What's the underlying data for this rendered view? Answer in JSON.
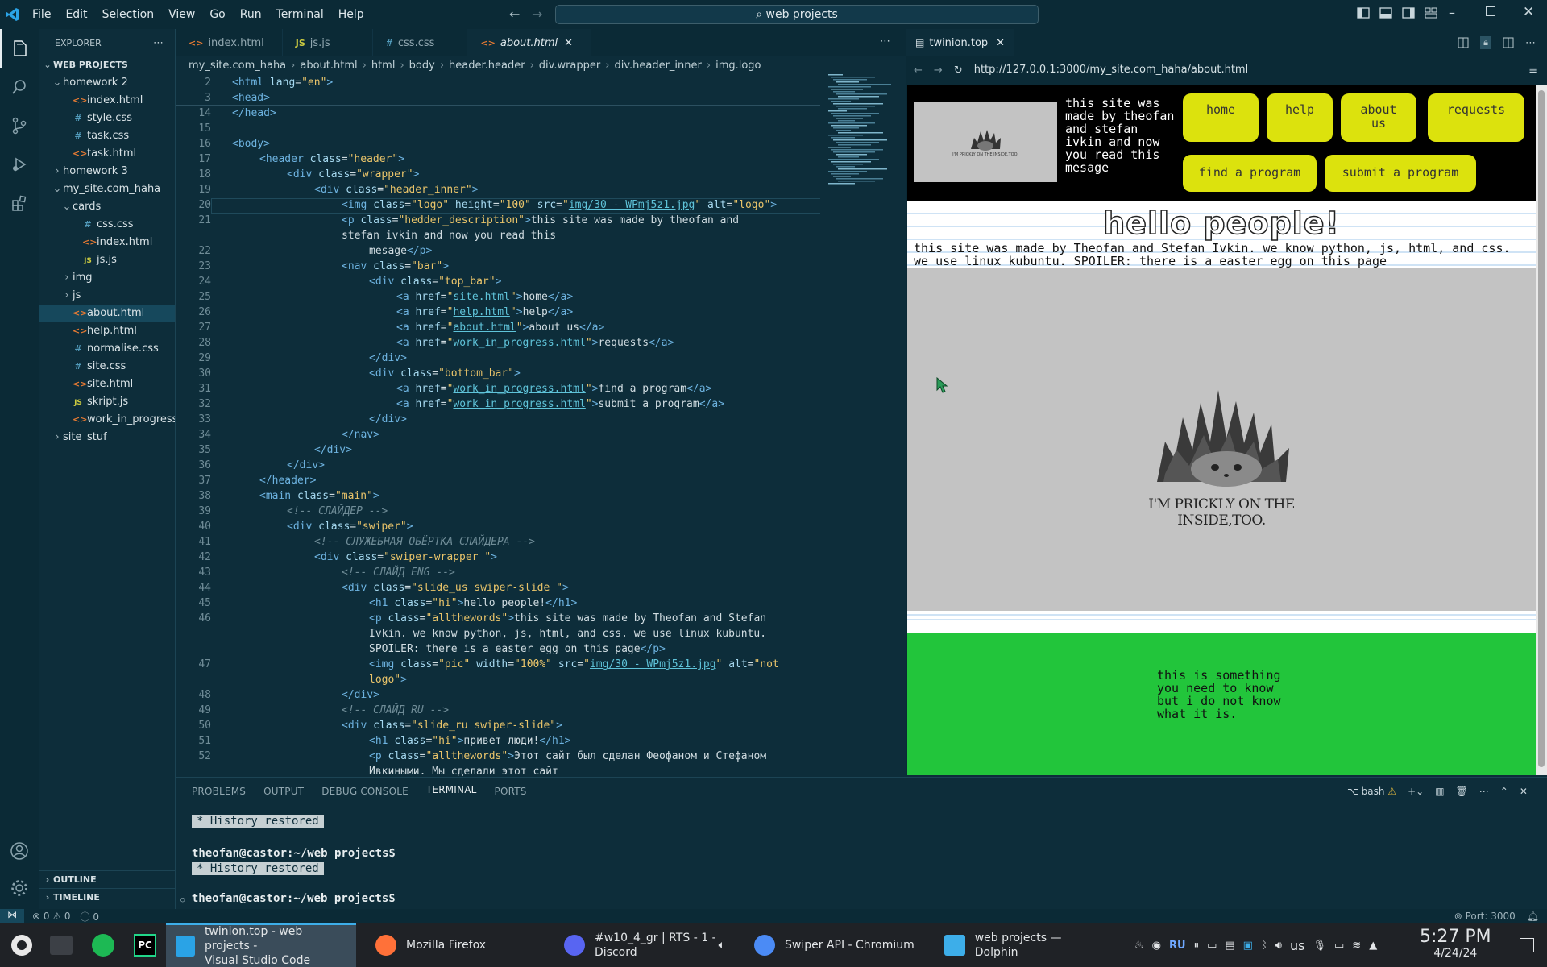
{
  "menubar": {
    "items": [
      "File",
      "Edit",
      "Selection",
      "View",
      "Go",
      "Run",
      "Terminal",
      "Help"
    ],
    "search": "web projects"
  },
  "explorer": {
    "title": "EXPLORER",
    "workspace": "WEB PROJECTS",
    "outline": "OUTLINE",
    "timeline": "TIMELINE",
    "items": [
      {
        "label": "homework 2",
        "kind": "folder-open",
        "indent": 1,
        "icon": ""
      },
      {
        "label": "index.html",
        "kind": "file",
        "indent": 2,
        "icon": "<>",
        "color": "#e37933"
      },
      {
        "label": "style.css",
        "kind": "file",
        "indent": 2,
        "icon": "#",
        "color": "#519aba"
      },
      {
        "label": "task.css",
        "kind": "file",
        "indent": 2,
        "icon": "#",
        "color": "#519aba"
      },
      {
        "label": "task.html",
        "kind": "file",
        "indent": 2,
        "icon": "<>",
        "color": "#e37933"
      },
      {
        "label": "homework 3",
        "kind": "folder",
        "indent": 1,
        "icon": ""
      },
      {
        "label": "my_site.com_haha",
        "kind": "folder-open",
        "indent": 1,
        "icon": ""
      },
      {
        "label": "cards",
        "kind": "folder-open",
        "indent": 2,
        "icon": ""
      },
      {
        "label": "css.css",
        "kind": "file",
        "indent": 3,
        "icon": "#",
        "color": "#519aba"
      },
      {
        "label": "index.html",
        "kind": "file",
        "indent": 3,
        "icon": "<>",
        "color": "#e37933"
      },
      {
        "label": "js.js",
        "kind": "file",
        "indent": 3,
        "icon": "JS",
        "color": "#cbcb41"
      },
      {
        "label": "img",
        "kind": "folder",
        "indent": 2,
        "icon": ""
      },
      {
        "label": "js",
        "kind": "folder",
        "indent": 2,
        "icon": ""
      },
      {
        "label": "about.html",
        "kind": "file",
        "indent": 2,
        "icon": "<>",
        "color": "#e37933",
        "selected": true
      },
      {
        "label": "help.html",
        "kind": "file",
        "indent": 2,
        "icon": "<>",
        "color": "#e37933"
      },
      {
        "label": "normalise.css",
        "kind": "file",
        "indent": 2,
        "icon": "#",
        "color": "#519aba"
      },
      {
        "label": "site.css",
        "kind": "file",
        "indent": 2,
        "icon": "#",
        "color": "#519aba"
      },
      {
        "label": "site.html",
        "kind": "file",
        "indent": 2,
        "icon": "<>",
        "color": "#e37933"
      },
      {
        "label": "skript.js",
        "kind": "file",
        "indent": 2,
        "icon": "JS",
        "color": "#cbcb41"
      },
      {
        "label": "work_in_progress....",
        "kind": "file",
        "indent": 2,
        "icon": "<>",
        "color": "#e37933"
      },
      {
        "label": "site_stuf",
        "kind": "folder",
        "indent": 1,
        "icon": ""
      }
    ]
  },
  "tabs": [
    {
      "label": "index.html",
      "icon": "<>",
      "color": "#e37933"
    },
    {
      "label": "js.js",
      "icon": "JS",
      "color": "#cbcb41"
    },
    {
      "label": "css.css",
      "icon": "#",
      "color": "#519aba"
    },
    {
      "label": "about.html",
      "icon": "<>",
      "color": "#e37933",
      "active": true
    }
  ],
  "breadcrumb": [
    "my_site.com_haha",
    "about.html",
    "html",
    "body",
    "header.header",
    "div.wrapper",
    "div.header_inner",
    "img.logo"
  ],
  "code": [
    {
      "n": "2",
      "i": 0,
      "h": "<span class=tg>&lt;html</span> <span class=at>lang</span>=<span class=st>\"en\"</span><span class=tg>&gt;</span>"
    },
    {
      "n": "3",
      "i": 0,
      "h": "<span class=tg>&lt;head&gt;</span>"
    },
    {
      "n": "14",
      "i": 0,
      "h": "<span class=tg>&lt;/head&gt;</span>"
    },
    {
      "n": "15",
      "i": 0,
      "h": ""
    },
    {
      "n": "16",
      "i": 0,
      "h": "<span class=tg>&lt;body&gt;</span>"
    },
    {
      "n": "17",
      "i": 1,
      "h": "<span class=tg>&lt;header</span> <span class=at>class</span>=<span class=st>\"header\"</span><span class=tg>&gt;</span>"
    },
    {
      "n": "18",
      "i": 2,
      "h": "<span class=tg>&lt;div</span> <span class=at>class</span>=<span class=st>\"wrapper\"</span><span class=tg>&gt;</span>"
    },
    {
      "n": "19",
      "i": 3,
      "h": "<span class=tg>&lt;div</span> <span class=at>class</span>=<span class=st>\"header_inner\"</span><span class=tg>&gt;</span>"
    },
    {
      "n": "20",
      "i": 4,
      "h": "<span class=tg>&lt;img</span> <span class=at>class</span>=<span class=st>\"logo\"</span> <span class=at>height</span>=<span class=st>\"100\"</span> <span class=at>src</span>=<span class=st>\"</span><span class=lk>img/30 - WPmj5z1.jpg</span><span class=st>\"</span> <span class=at>alt</span>=<span class=st>\"logo\"</span><span class=tg>&gt;</span>",
      "hl": true
    },
    {
      "n": "21",
      "i": 4,
      "h": "<span class=tg>&lt;p</span> <span class=at>class</span>=<span class=st>\"hedder_description\"</span><span class=tg>&gt;</span>this site was made by theofan and"
    },
    {
      "n": "",
      "i": 4,
      "h": "stefan ivkin and now you read this"
    },
    {
      "n": "22",
      "i": 5,
      "h": "mesage<span class=tg>&lt;/p&gt;</span>"
    },
    {
      "n": "23",
      "i": 4,
      "h": "<span class=tg>&lt;nav</span> <span class=at>class</span>=<span class=st>\"bar\"</span><span class=tg>&gt;</span>"
    },
    {
      "n": "24",
      "i": 5,
      "h": "<span class=tg>&lt;div</span> <span class=at>class</span>=<span class=st>\"top_bar\"</span><span class=tg>&gt;</span>"
    },
    {
      "n": "25",
      "i": 6,
      "h": "<span class=tg>&lt;a</span> <span class=at>href</span>=<span class=st>\"</span><span class=lk>site.html</span><span class=st>\"</span><span class=tg>&gt;</span>home<span class=tg>&lt;/a&gt;</span>"
    },
    {
      "n": "26",
      "i": 6,
      "h": "<span class=tg>&lt;a</span> <span class=at>href</span>=<span class=st>\"</span><span class=lk>help.html</span><span class=st>\"</span><span class=tg>&gt;</span>help<span class=tg>&lt;/a&gt;</span>"
    },
    {
      "n": "27",
      "i": 6,
      "h": "<span class=tg>&lt;a</span> <span class=at>href</span>=<span class=st>\"</span><span class=lk>about.html</span><span class=st>\"</span><span class=tg>&gt;</span>about us<span class=tg>&lt;/a&gt;</span>"
    },
    {
      "n": "28",
      "i": 6,
      "h": "<span class=tg>&lt;a</span> <span class=at>href</span>=<span class=st>\"</span><span class=lk>work_in_progress.html</span><span class=st>\"</span><span class=tg>&gt;</span>requests<span class=tg>&lt;/a&gt;</span>"
    },
    {
      "n": "29",
      "i": 5,
      "h": "<span class=tg>&lt;/div&gt;</span>"
    },
    {
      "n": "30",
      "i": 5,
      "h": "<span class=tg>&lt;div</span> <span class=at>class</span>=<span class=st>\"bottom_bar\"</span><span class=tg>&gt;</span>"
    },
    {
      "n": "31",
      "i": 6,
      "h": "<span class=tg>&lt;a</span> <span class=at>href</span>=<span class=st>\"</span><span class=lk>work_in_progress.html</span><span class=st>\"</span><span class=tg>&gt;</span>find a program<span class=tg>&lt;/a&gt;</span>"
    },
    {
      "n": "32",
      "i": 6,
      "h": "<span class=tg>&lt;a</span> <span class=at>href</span>=<span class=st>\"</span><span class=lk>work_in_progress.html</span><span class=st>\"</span><span class=tg>&gt;</span>submit a program<span class=tg>&lt;/a&gt;</span>"
    },
    {
      "n": "33",
      "i": 5,
      "h": "<span class=tg>&lt;/div&gt;</span>"
    },
    {
      "n": "34",
      "i": 4,
      "h": "<span class=tg>&lt;/nav&gt;</span>"
    },
    {
      "n": "35",
      "i": 3,
      "h": "<span class=tg>&lt;/div&gt;</span>"
    },
    {
      "n": "36",
      "i": 2,
      "h": "<span class=tg>&lt;/div&gt;</span>"
    },
    {
      "n": "37",
      "i": 1,
      "h": "<span class=tg>&lt;/header&gt;</span>"
    },
    {
      "n": "38",
      "i": 1,
      "h": "<span class=tg>&lt;main</span> <span class=at>class</span>=<span class=st>\"main\"</span><span class=tg>&gt;</span>"
    },
    {
      "n": "39",
      "i": 2,
      "h": "<span class=cm>&lt;!-- СЛАЙДЕР --&gt;</span>"
    },
    {
      "n": "40",
      "i": 2,
      "h": "<span class=tg>&lt;div</span> <span class=at>class</span>=<span class=st>\"swiper\"</span><span class=tg>&gt;</span>"
    },
    {
      "n": "41",
      "i": 3,
      "h": "<span class=cm>&lt;!-- СЛУЖЕБНАЯ ОБЁРТКА СЛАЙДЕРА --&gt;</span>"
    },
    {
      "n": "42",
      "i": 3,
      "h": "<span class=tg>&lt;div</span> <span class=at>class</span>=<span class=st>\"swiper-wrapper \"</span><span class=tg>&gt;</span>"
    },
    {
      "n": "43",
      "i": 4,
      "h": "<span class=cm>&lt;!-- СЛАЙД ENG --&gt;</span>"
    },
    {
      "n": "44",
      "i": 4,
      "h": "<span class=tg>&lt;div</span> <span class=at>class</span>=<span class=st>\"slide_us swiper-slide \"</span><span class=tg>&gt;</span>"
    },
    {
      "n": "45",
      "i": 5,
      "h": "<span class=tg>&lt;h1</span> <span class=at>class</span>=<span class=st>\"hi\"</span><span class=tg>&gt;</span>hello people!<span class=tg>&lt;/h1&gt;</span>"
    },
    {
      "n": "46",
      "i": 5,
      "h": "<span class=tg>&lt;p</span> <span class=at>class</span>=<span class=st>\"allthewords\"</span><span class=tg>&gt;</span>this site was made by Theofan and Stefan"
    },
    {
      "n": "",
      "i": 5,
      "h": "Ivkin. we know python, js, html, and css. we use linux kubuntu."
    },
    {
      "n": "",
      "i": 5,
      "h": "SPOILER: there is a easter egg on this page<span class=tg>&lt;/p&gt;</span>"
    },
    {
      "n": "47",
      "i": 5,
      "h": "<span class=tg>&lt;img</span> <span class=at>class</span>=<span class=st>\"pic\"</span> <span class=at>width</span>=<span class=st>\"100%\"</span> <span class=at>src</span>=<span class=st>\"</span><span class=lk>img/30 - WPmj5z1.jpg</span><span class=st>\"</span> <span class=at>alt</span>=<span class=st>\"not</span>"
    },
    {
      "n": "",
      "i": 5,
      "h": "<span class=st>logo\"</span><span class=tg>&gt;</span>"
    },
    {
      "n": "48",
      "i": 4,
      "h": "<span class=tg>&lt;/div&gt;</span>"
    },
    {
      "n": "49",
      "i": 4,
      "h": "<span class=cm>&lt;!-- СЛАЙД RU --&gt;</span>"
    },
    {
      "n": "50",
      "i": 4,
      "h": "<span class=tg>&lt;div</span> <span class=at>class</span>=<span class=st>\"slide_ru swiper-slide\"</span><span class=tg>&gt;</span>"
    },
    {
      "n": "51",
      "i": 5,
      "h": "<span class=tg>&lt;h1</span> <span class=at>class</span>=<span class=st>\"hi\"</span><span class=tg>&gt;</span>привет люди!<span class=tg>&lt;/h1&gt;</span>"
    },
    {
      "n": "52",
      "i": 5,
      "h": "<span class=tg>&lt;p</span> <span class=at>class</span>=<span class=st>\"allthewords\"</span><span class=tg>&gt;</span>Этот сайт был сделан Феофаном и Стефаном"
    },
    {
      "n": "",
      "i": 5,
      "h": "Ивкиными. Мы сделали этот сайт"
    }
  ],
  "browser": {
    "tab_title": "twinion.top",
    "url": "http://127.0.0.1:3000/my_site.com_haha/about.html",
    "header_description": "this site was made by theofan and stefan ivkin and now you read this mesage",
    "logo_caption": "I'M PRICKLY ON THE INSIDE,TOO.",
    "nav": [
      "home",
      "help",
      "about us",
      "requests",
      "find a program",
      "submit a program"
    ],
    "heading": "hello people!",
    "paragraph": "this site was made by Theofan and Stefan Ivkin. we know python, js, html, and css. we use linux kubuntu. SPOILER: there is a easter egg on this page",
    "image_caption": "I'M PRICKLY ON THE INSIDE,TOO.",
    "footer_text": "this is something you need to know but i do not know what it is.",
    "accent": "#dce20d",
    "footer_color": "#22c53b"
  },
  "panel": {
    "tabs": [
      "PROBLEMS",
      "OUTPUT",
      "DEBUG CONSOLE",
      "TERMINAL",
      "PORTS"
    ],
    "active_tab": "TERMINAL",
    "shell": "bash",
    "history": "History restored",
    "prompt": "theofan@castor:~/web projects$"
  },
  "status": {
    "errors": "0",
    "warnings": "0",
    "info": "0",
    "port": "Port: 3000"
  },
  "taskbar": {
    "apps": [
      {
        "title": "twinion.top - web projects -",
        "title2": "Visual Studio Code",
        "icon": "vscode-icon",
        "active": true
      },
      {
        "title": "Mozilla Firefox",
        "title2": "",
        "icon": "firefox-icon"
      },
      {
        "title": "#w10_4_gr | RTS - 1 -",
        "title2": "Discord",
        "icon": "discord-icon"
      },
      {
        "title": "Swiper API - Chromium",
        "title2": "",
        "icon": "chromium-icon"
      },
      {
        "title": "web projects — Dolphin",
        "title2": "",
        "icon": "dolphin-icon"
      }
    ],
    "lang": "RU",
    "layout": "us",
    "time": "5:27 PM",
    "date": "4/24/24"
  }
}
